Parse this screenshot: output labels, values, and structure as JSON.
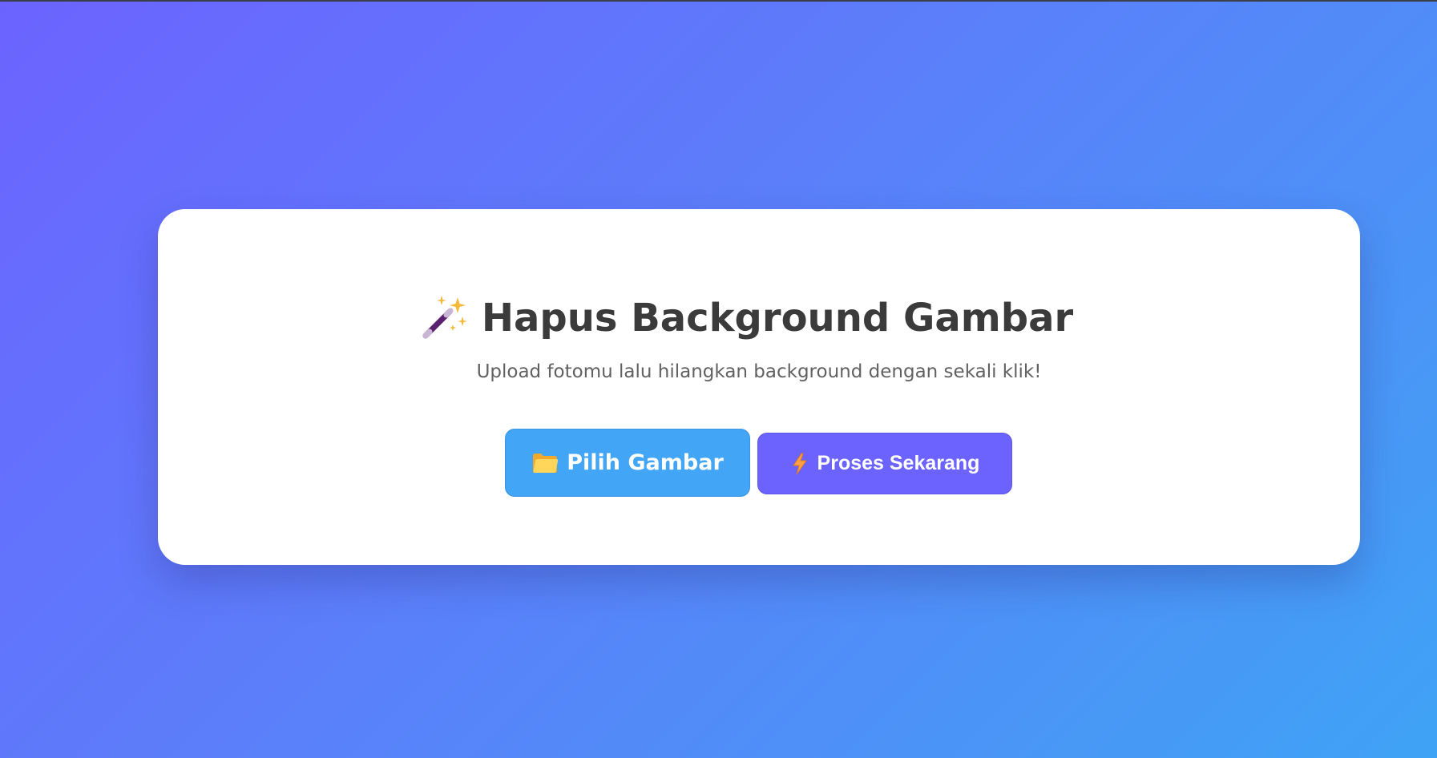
{
  "header": {
    "title": "Hapus Background Gambar",
    "title_icon": "magic-wand-icon",
    "subtitle": "Upload fotomu lalu hilangkan background dengan sekali klik!"
  },
  "actions": {
    "choose_label": "Pilih Gambar",
    "choose_icon": "folder-icon",
    "process_label": "Proses Sekarang",
    "process_icon": "lightning-icon"
  },
  "colors": {
    "background_gradient_start": "#6c63ff",
    "background_gradient_end": "#3fa3f5",
    "card": "#ffffff",
    "title_text": "#3b3b3b",
    "subtitle_text": "#616161",
    "choose_button": "#42a5f5",
    "process_button": "#6c63ff",
    "button_text": "#ffffff"
  }
}
